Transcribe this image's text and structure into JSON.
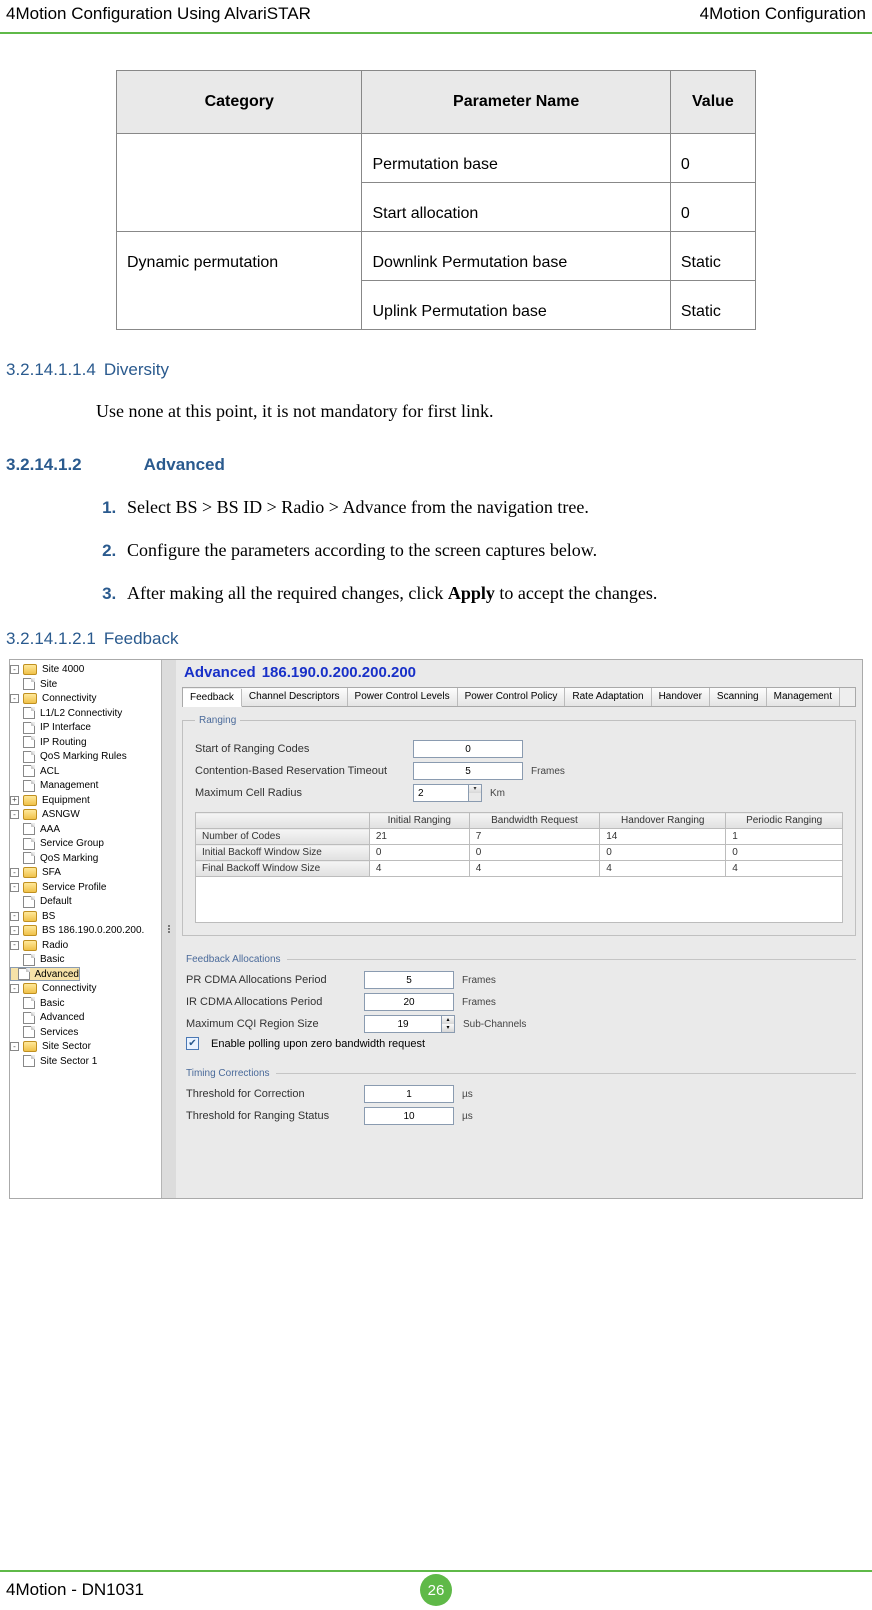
{
  "header": {
    "left": "4Motion Configuration Using AlvariSTAR",
    "right": "4Motion Configuration"
  },
  "paramTable": {
    "headers": [
      "Category",
      "Parameter Name",
      "Value"
    ],
    "rows": [
      {
        "category": "",
        "param": "Permutation base",
        "value": "0"
      },
      {
        "category": "",
        "param": "Start allocation",
        "value": "0"
      },
      {
        "category": "Dynamic permutation",
        "param": "Downlink Permutation base",
        "value": "Static"
      },
      {
        "category": "",
        "param": "Uplink Permutation base",
        "value": "Static"
      }
    ]
  },
  "sections": {
    "diversity_num": "3.2.14.1.1.4",
    "diversity_title": "Diversity",
    "diversity_body": "Use none at this point, it is not mandatory for first link.",
    "advanced_num": "3.2.14.1.2",
    "advanced_title": "Advanced",
    "steps": [
      "Select BS > BS ID > Radio > Advance from the navigation tree.",
      "Configure the parameters according to the screen captures below.",
      "After making all the required changes, click Apply to accept the changes."
    ],
    "step3_pre": "After making all the required changes, click ",
    "step3_bold": "Apply",
    "step3_post": " to accept the changes.",
    "feedback_num": "3.2.14.1.2.1",
    "feedback_title": "Feedback"
  },
  "screenshot": {
    "title": "Advanced",
    "ip": "186.190.0.200.200.200",
    "tree": [
      {
        "depth": 1,
        "icon": "folder",
        "toggle": "-",
        "label": "Site 4000"
      },
      {
        "depth": 2,
        "icon": "file",
        "label": "Site"
      },
      {
        "depth": 2,
        "icon": "folder",
        "toggle": "-",
        "label": "Connectivity"
      },
      {
        "depth": 3,
        "icon": "file",
        "label": "L1/L2 Connectivity"
      },
      {
        "depth": 3,
        "icon": "file",
        "label": "IP Interface"
      },
      {
        "depth": 3,
        "icon": "file",
        "label": "IP Routing"
      },
      {
        "depth": 3,
        "icon": "file",
        "label": "QoS Marking Rules"
      },
      {
        "depth": 3,
        "icon": "file",
        "label": "ACL"
      },
      {
        "depth": 2,
        "icon": "file",
        "label": "Management"
      },
      {
        "depth": 2,
        "icon": "folder",
        "toggle": "+",
        "label": "Equipment"
      },
      {
        "depth": 2,
        "icon": "folder",
        "toggle": "-",
        "label": "ASNGW"
      },
      {
        "depth": 3,
        "icon": "file",
        "label": "AAA"
      },
      {
        "depth": 3,
        "icon": "file",
        "label": "Service Group"
      },
      {
        "depth": 3,
        "icon": "file",
        "label": "QoS Marking"
      },
      {
        "depth": 3,
        "icon": "folder",
        "toggle": "-",
        "label": "SFA"
      },
      {
        "depth": 4,
        "icon": "folder",
        "toggle": "-",
        "label": "Service Profile"
      },
      {
        "depth": 5,
        "icon": "file",
        "label": "Default"
      },
      {
        "depth": 2,
        "icon": "folder",
        "toggle": "-",
        "label": "BS"
      },
      {
        "depth": 3,
        "icon": "folder",
        "toggle": "-",
        "label": "BS 186.190.0.200.200."
      },
      {
        "depth": 4,
        "icon": "folder",
        "toggle": "-",
        "label": "Radio"
      },
      {
        "depth": 5,
        "icon": "file",
        "label": "Basic"
      },
      {
        "depth": 5,
        "icon": "file",
        "label": "Advanced",
        "selected": true
      },
      {
        "depth": 4,
        "icon": "folder",
        "toggle": "-",
        "label": "Connectivity"
      },
      {
        "depth": 5,
        "icon": "file",
        "label": "Basic"
      },
      {
        "depth": 5,
        "icon": "file",
        "label": "Advanced"
      },
      {
        "depth": 4,
        "icon": "file",
        "label": "Services"
      },
      {
        "depth": 2,
        "icon": "folder",
        "toggle": "-",
        "label": "Site Sector"
      },
      {
        "depth": 3,
        "icon": "file",
        "label": "Site Sector 1"
      }
    ],
    "tabs": [
      "Feedback",
      "Channel Descriptors",
      "Power Control Levels",
      "Power Control Policy",
      "Rate Adaptation",
      "Handover",
      "Scanning",
      "Management"
    ],
    "active_tab": 0,
    "ranging": {
      "legend": "Ranging",
      "fields": {
        "start_label": "Start of Ranging Codes",
        "start_value": "0",
        "contention_label": "Contention-Based Reservation Timeout",
        "contention_value": "5",
        "contention_unit": "Frames",
        "maxcell_label": "Maximum Cell Radius",
        "maxcell_value": "2",
        "maxcell_unit": "Km"
      },
      "table_headers": [
        "",
        "Initial Ranging",
        "Bandwidth Request",
        "Handover Ranging",
        "Periodic Ranging"
      ],
      "table_rows": [
        {
          "label": "Number of Codes",
          "v": [
            "21",
            "7",
            "14",
            "1"
          ]
        },
        {
          "label": "Initial Backoff Window Size",
          "v": [
            "0",
            "0",
            "0",
            "0"
          ]
        },
        {
          "label": "Final Backoff Window Size",
          "v": [
            "4",
            "4",
            "4",
            "4"
          ]
        }
      ]
    },
    "feedback_alloc": {
      "legend": "Feedback Allocations",
      "pr_label": "PR CDMA Allocations Period",
      "pr_value": "5",
      "pr_unit": "Frames",
      "ir_label": "IR CDMA Allocations Period",
      "ir_value": "20",
      "ir_unit": "Frames",
      "cqi_label": "Maximum CQI Region Size",
      "cqi_value": "19",
      "cqi_unit": "Sub-Channels",
      "enable_label": "Enable polling upon zero bandwidth request"
    },
    "timing": {
      "legend": "Timing Corrections",
      "thc_label": "Threshold for Correction",
      "thc_value": "1",
      "thc_unit": "µs",
      "thr_label": "Threshold for Ranging Status",
      "thr_value": "10",
      "thr_unit": "µs"
    }
  },
  "footer": {
    "left": "4Motion - DN1031",
    "page": "26"
  }
}
